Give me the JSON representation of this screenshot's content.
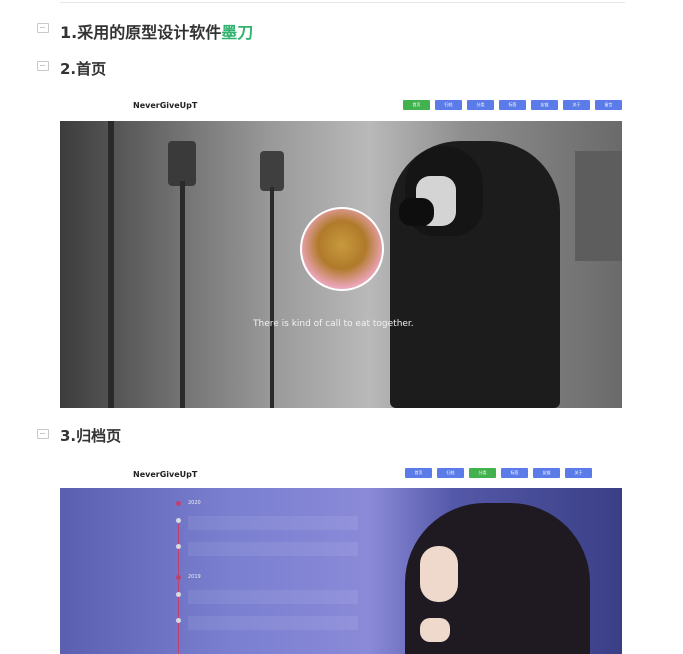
{
  "doc": {
    "section1": {
      "title": "1.采用的原型设计软件",
      "tool": "墨刀"
    },
    "section2": {
      "title": "2.首页"
    },
    "section3": {
      "title": "3.归档页"
    }
  },
  "home_mock": {
    "brand": "NeverGiveUpT",
    "nav": [
      "首页",
      "归档",
      "分类",
      "标签",
      "友链",
      "关于",
      "留言"
    ],
    "active_index": 0,
    "slogan": "There is kind of call to eat together."
  },
  "archive_mock": {
    "brand": "NeverGiveUpT",
    "nav": [
      "首页",
      "归档",
      "分类",
      "标签",
      "友链",
      "关于"
    ],
    "active_index": 2,
    "years": [
      "2020",
      "2019"
    ]
  },
  "colors": {
    "accent": "#2fb36e",
    "nav_button": "#5b7be8",
    "nav_active": "#42b24f"
  }
}
